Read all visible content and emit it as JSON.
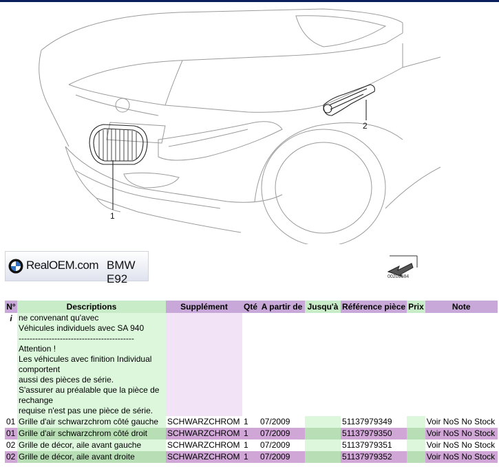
{
  "drawing": {
    "callouts": [
      "1",
      "2"
    ]
  },
  "logo": {
    "brand": "RealOEM.com",
    "model": "BMW E92"
  },
  "diagram_id": "00208584",
  "table": {
    "headers": [
      "N°",
      "Descriptions",
      "Supplément",
      "Qté",
      "A partir de",
      "Jusqu'à",
      "Référence pièce",
      "Prix",
      "Note"
    ],
    "info": {
      "marker": "i",
      "lines": [
        "ne convenant qu'avec",
        "Véhicules individuels avec SA 940",
        "------------------------------------------",
        "Attention !",
        "Les véhicules avec finition Individual comportent",
        "aussi des pièces de série.",
        "S'assurer au préalable que la pièce de rechange",
        "requise n'est pas une pièce de série."
      ]
    },
    "rows": [
      {
        "no": "01",
        "desc": "Grille d'air schwarzchrom côté gauche",
        "supp": "SCHWARZCHROM",
        "qty": "1",
        "from": "07/2009",
        "to": "",
        "ref": "51137979349",
        "price": "",
        "note": "Voir NoS No Stock"
      },
      {
        "no": "01",
        "desc": "Grille d'air schwarzchrom côté droit",
        "supp": "SCHWARZCHROM",
        "qty": "1",
        "from": "07/2009",
        "to": "",
        "ref": "51137979350",
        "price": "",
        "note": "Voir NoS No Stock"
      },
      {
        "no": "02",
        "desc": "Grille de décor, aile avant gauche",
        "supp": "SCHWARZCHROM",
        "qty": "1",
        "from": "07/2009",
        "to": "",
        "ref": "51137979351",
        "price": "",
        "note": "Voir NoS No Stock"
      },
      {
        "no": "02",
        "desc": "Grille de décor, aile avant droite",
        "supp": "SCHWARZCHROM",
        "qty": "1",
        "from": "07/2009",
        "to": "",
        "ref": "51137979352",
        "price": "",
        "note": "Voir NoS No Stock"
      }
    ]
  }
}
